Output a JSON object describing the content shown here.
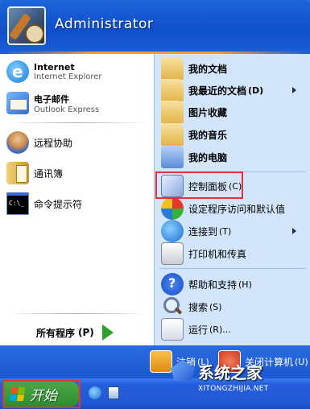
{
  "user": {
    "name": "Administrator"
  },
  "left_pinned": [
    {
      "title": "Internet",
      "subtitle": "Internet Explorer",
      "icon": "internet-explorer-icon"
    },
    {
      "title": "电子邮件",
      "subtitle": "Outlook Express",
      "icon": "outlook-express-icon"
    }
  ],
  "left_recent": [
    {
      "label": "远程协助",
      "icon": "remote-assistance-icon"
    },
    {
      "label": "通讯簿",
      "icon": "address-book-icon"
    },
    {
      "label": "命令提示符",
      "icon": "command-prompt-icon"
    }
  ],
  "all_programs": {
    "label": "所有程序",
    "accel": "(P)"
  },
  "right_places": [
    {
      "label": "我的文档",
      "icon": "my-documents-icon",
      "bold": true
    },
    {
      "label": "我最近的文档",
      "accel": "(D)",
      "icon": "recent-documents-icon",
      "bold": true,
      "submenu": true
    },
    {
      "label": "图片收藏",
      "icon": "my-pictures-icon",
      "bold": true
    },
    {
      "label": "我的音乐",
      "icon": "my-music-icon",
      "bold": true
    },
    {
      "label": "我的电脑",
      "icon": "my-computer-icon",
      "bold": true
    }
  ],
  "right_system": [
    {
      "label": "控制面板",
      "accel": "(C)",
      "icon": "control-panel-icon",
      "highlighted": true
    },
    {
      "label": "设定程序访问和默认值",
      "icon": "program-access-icon"
    },
    {
      "label": "连接到",
      "accel": "(T)",
      "icon": "connect-to-icon",
      "submenu": true
    },
    {
      "label": "打印机和传真",
      "icon": "printers-faxes-icon"
    }
  ],
  "right_help": [
    {
      "label": "帮助和支持",
      "accel": "(H)",
      "icon": "help-support-icon"
    },
    {
      "label": "搜索",
      "accel": "(S)",
      "icon": "search-icon"
    },
    {
      "label": "运行",
      "accel": "(R)...",
      "icon": "run-icon"
    }
  ],
  "footer": {
    "logoff": "注销",
    "logoff_accel": "(L)",
    "shutdown": "关闭计算机",
    "shutdown_accel": "(U)"
  },
  "taskbar": {
    "start": "开始"
  },
  "watermark": {
    "title": "系统之家",
    "url": "XITONGZHIJIA.NET"
  },
  "colors": {
    "highlight_box": "#e2323c",
    "right_pane": "#d3e5fa",
    "start_button": "#3c9a3c"
  }
}
